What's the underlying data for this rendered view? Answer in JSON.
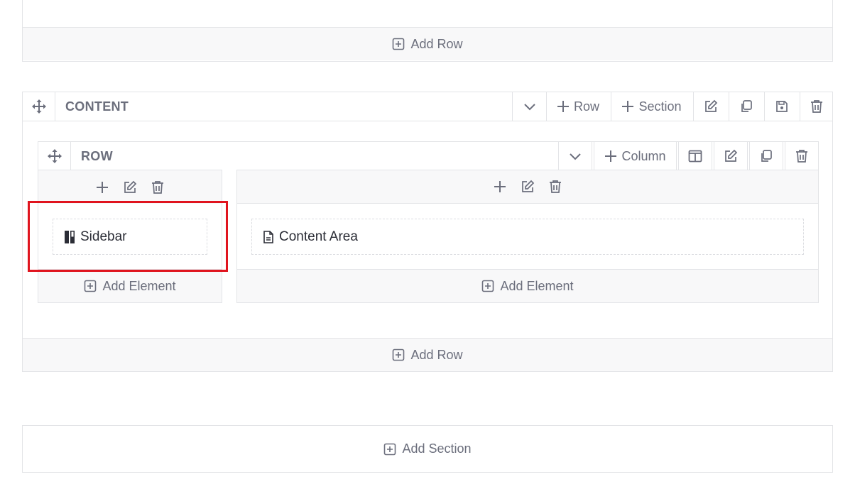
{
  "top_section": {
    "add_row_label": "Add Row"
  },
  "content_section": {
    "title": "CONTENT",
    "toolbar": {
      "row_label": "Row",
      "section_label": "Section"
    },
    "row": {
      "title": "ROW",
      "toolbar": {
        "column_label": "Column"
      },
      "columns": [
        {
          "element": {
            "label": "Sidebar",
            "icon": "sidebar-icon"
          },
          "add_element_label": "Add Element"
        },
        {
          "element": {
            "label": "Content Area",
            "icon": "document-icon"
          },
          "add_element_label": "Add Element"
        }
      ]
    },
    "add_row_label": "Add Row"
  },
  "add_section_label": "Add Section",
  "colors": {
    "highlight": "#e0141e",
    "border": "#e3e4e7",
    "bar_bg": "#f8f8f9",
    "text": "#6b6e7c"
  }
}
